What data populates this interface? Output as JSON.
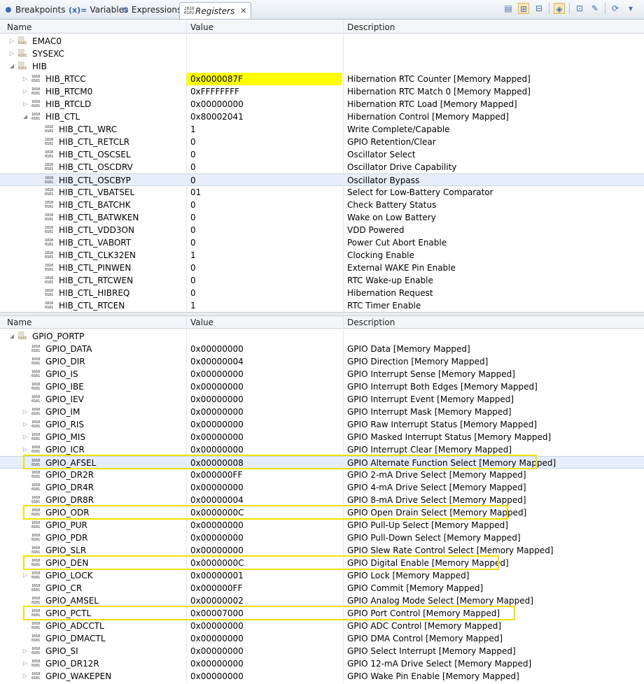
{
  "tabs": [
    {
      "label": "Breakpoints",
      "icon": "breakpoint-icon",
      "active": false
    },
    {
      "label": "Variables",
      "icon": "variables-icon",
      "prefix": "(x)=",
      "active": false
    },
    {
      "label": "Expressions",
      "icon": "expressions-icon",
      "active": false
    },
    {
      "label": "Registers",
      "icon": "registers-icon",
      "active": true
    }
  ],
  "toolbar_icons": [
    "layout-icon",
    "toggle-columns-icon",
    "collapse-icon",
    "group-icon",
    "new-group-icon",
    "edit-group-icon",
    "refresh-icon",
    "view-menu-icon"
  ],
  "columns": {
    "name": "Name",
    "value": "Value",
    "description": "Description"
  },
  "top_rows": [
    {
      "level": 0,
      "twisty": "right",
      "group": true,
      "name": "EMAC0",
      "value": "",
      "desc": ""
    },
    {
      "level": 0,
      "twisty": "right",
      "group": true,
      "name": "SYSEXC",
      "value": "",
      "desc": ""
    },
    {
      "level": 0,
      "twisty": "down",
      "group": true,
      "name": "HIB",
      "value": "",
      "desc": ""
    },
    {
      "level": 1,
      "twisty": "right",
      "name": "HIB_RTCC",
      "value": "0x0000087F",
      "desc": "Hibernation RTC Counter [Memory Mapped]",
      "highlight": true
    },
    {
      "level": 1,
      "twisty": "right",
      "name": "HIB_RTCM0",
      "value": "0xFFFFFFFF",
      "desc": "Hibernation RTC Match 0 [Memory Mapped]"
    },
    {
      "level": 1,
      "twisty": "right",
      "name": "HIB_RTCLD",
      "value": "0x00000000",
      "desc": "Hibernation RTC Load [Memory Mapped]"
    },
    {
      "level": 1,
      "twisty": "down",
      "name": "HIB_CTL",
      "value": "0x80002041",
      "desc": "Hibernation Control [Memory Mapped]"
    },
    {
      "level": 2,
      "name": "HIB_CTL_WRC",
      "value": "1",
      "desc": "Write Complete/Capable"
    },
    {
      "level": 2,
      "name": "HIB_CTL_RETCLR",
      "value": "0",
      "desc": "GPIO Retention/Clear"
    },
    {
      "level": 2,
      "name": "HIB_CTL_OSCSEL",
      "value": "0",
      "desc": "Oscillator Select"
    },
    {
      "level": 2,
      "name": "HIB_CTL_OSCDRV",
      "value": "0",
      "desc": "Oscillator Drive Capability"
    },
    {
      "level": 2,
      "name": "HIB_CTL_OSCBYP",
      "value": "0",
      "desc": "Oscillator Bypass",
      "selected": true
    },
    {
      "level": 2,
      "name": "HIB_CTL_VBATSEL",
      "value": "01",
      "desc": "Select for Low-Battery Comparator"
    },
    {
      "level": 2,
      "name": "HIB_CTL_BATCHK",
      "value": "0",
      "desc": "Check Battery Status"
    },
    {
      "level": 2,
      "name": "HIB_CTL_BATWKEN",
      "value": "0",
      "desc": "Wake on Low Battery"
    },
    {
      "level": 2,
      "name": "HIB_CTL_VDD3ON",
      "value": "0",
      "desc": "VDD Powered"
    },
    {
      "level": 2,
      "name": "HIB_CTL_VABORT",
      "value": "0",
      "desc": "Power Cut Abort Enable"
    },
    {
      "level": 2,
      "name": "HIB_CTL_CLK32EN",
      "value": "1",
      "desc": "Clocking Enable"
    },
    {
      "level": 2,
      "name": "HIB_CTL_PINWEN",
      "value": "0",
      "desc": "External WAKE Pin Enable"
    },
    {
      "level": 2,
      "name": "HIB_CTL_RTCWEN",
      "value": "0",
      "desc": "RTC Wake-up Enable"
    },
    {
      "level": 2,
      "name": "HIB_CTL_HIBREQ",
      "value": "0",
      "desc": "Hibernation Request"
    },
    {
      "level": 2,
      "name": "HIB_CTL_RTCEN",
      "value": "1",
      "desc": "RTC Timer Enable"
    }
  ],
  "bottom_rows": [
    {
      "level": 0,
      "twisty": "down",
      "group": true,
      "name": "GPIO_PORTP",
      "value": "",
      "desc": ""
    },
    {
      "level": 1,
      "name": "GPIO_DATA",
      "value": "0x00000000",
      "desc": "GPIO Data [Memory Mapped]"
    },
    {
      "level": 1,
      "name": "GPIO_DIR",
      "value": "0x00000004",
      "desc": "GPIO Direction [Memory Mapped]"
    },
    {
      "level": 1,
      "name": "GPIO_IS",
      "value": "0x00000000",
      "desc": "GPIO Interrupt Sense [Memory Mapped]"
    },
    {
      "level": 1,
      "name": "GPIO_IBE",
      "value": "0x00000000",
      "desc": "GPIO Interrupt Both Edges [Memory Mapped]"
    },
    {
      "level": 1,
      "name": "GPIO_IEV",
      "value": "0x00000000",
      "desc": "GPIO Interrupt Event [Memory Mapped]"
    },
    {
      "level": 1,
      "twisty": "right",
      "name": "GPIO_IM",
      "value": "0x00000000",
      "desc": "GPIO Interrupt Mask [Memory Mapped]"
    },
    {
      "level": 1,
      "twisty": "right",
      "name": "GPIO_RIS",
      "value": "0x00000000",
      "desc": "GPIO Raw Interrupt Status [Memory Mapped]"
    },
    {
      "level": 1,
      "twisty": "right",
      "name": "GPIO_MIS",
      "value": "0x00000000",
      "desc": "GPIO Masked Interrupt Status [Memory Mapped]"
    },
    {
      "level": 1,
      "twisty": "right",
      "name": "GPIO_ICR",
      "value": "0x00000000",
      "desc": "GPIO Interrupt Clear [Memory Mapped]"
    },
    {
      "level": 1,
      "name": "GPIO_AFSEL",
      "value": "0x00000008",
      "desc": "GPIO Alternate Function Select [Memory Mapped]",
      "selected": true,
      "outline": true
    },
    {
      "level": 1,
      "name": "GPIO_DR2R",
      "value": "0x000000FF",
      "desc": "GPIO 2-mA Drive Select [Memory Mapped]"
    },
    {
      "level": 1,
      "name": "GPIO_DR4R",
      "value": "0x00000000",
      "desc": "GPIO 4-mA Drive Select [Memory Mapped]"
    },
    {
      "level": 1,
      "name": "GPIO_DR8R",
      "value": "0x00000004",
      "desc": "GPIO 8-mA Drive Select [Memory Mapped]"
    },
    {
      "level": 1,
      "name": "GPIO_ODR",
      "value": "0x0000000C",
      "desc": "GPIO Open Drain Select [Memory Mapped]",
      "outline": true
    },
    {
      "level": 1,
      "name": "GPIO_PUR",
      "value": "0x00000000",
      "desc": "GPIO Pull-Up Select [Memory Mapped]"
    },
    {
      "level": 1,
      "name": "GPIO_PDR",
      "value": "0x00000000",
      "desc": "GPIO Pull-Down Select [Memory Mapped]"
    },
    {
      "level": 1,
      "name": "GPIO_SLR",
      "value": "0x00000000",
      "desc": "GPIO Slew Rate Control Select [Memory Mapped]"
    },
    {
      "level": 1,
      "name": "GPIO_DEN",
      "value": "0x0000000C",
      "desc": "GPIO Digital Enable [Memory Mapped]",
      "outline": true
    },
    {
      "level": 1,
      "twisty": "right",
      "name": "GPIO_LOCK",
      "value": "0x00000001",
      "desc": "GPIO Lock [Memory Mapped]"
    },
    {
      "level": 1,
      "name": "GPIO_CR",
      "value": "0x000000FF",
      "desc": "GPIO Commit [Memory Mapped]"
    },
    {
      "level": 1,
      "name": "GPIO_AMSEL",
      "value": "0x00000002",
      "desc": "GPIO Analog Mode Select [Memory Mapped]"
    },
    {
      "level": 1,
      "name": "GPIO_PCTL",
      "value": "0x00007000",
      "desc": "GPIO Port Control [Memory Mapped]",
      "outline": true
    },
    {
      "level": 1,
      "name": "GPIO_ADCCTL",
      "value": "0x00000000",
      "desc": "GPIO ADC Control [Memory Mapped]"
    },
    {
      "level": 1,
      "name": "GPIO_DMACTL",
      "value": "0x00000000",
      "desc": "GPIO DMA Control [Memory Mapped]"
    },
    {
      "level": 1,
      "twisty": "right",
      "name": "GPIO_SI",
      "value": "0x00000000",
      "desc": "GPIO Select Interrupt [Memory Mapped]"
    },
    {
      "level": 1,
      "twisty": "right",
      "name": "GPIO_DR12R",
      "value": "0x00000000",
      "desc": "GPIO 12-mA Drive Select [Memory Mapped]"
    },
    {
      "level": 1,
      "twisty": "right",
      "name": "GPIO_WAKEPEN",
      "value": "0x00000000",
      "desc": "GPIO Wake Pin Enable [Memory Mapped]"
    }
  ],
  "colors": {
    "highlight": "#ffff00",
    "outline": "#f2e000",
    "selection": "#e6eefb"
  }
}
